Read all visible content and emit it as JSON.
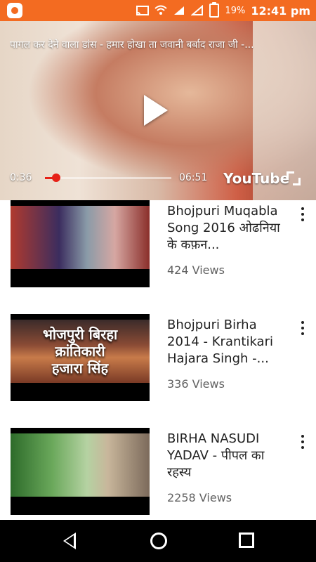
{
  "status": {
    "battery": "19%",
    "time": "12:41 pm",
    "accent": "#f36b21",
    "icons": [
      "app-icon",
      "cast-icon",
      "wifi-icon",
      "signal-icon",
      "signal-empty-icon",
      "battery-icon"
    ]
  },
  "player": {
    "title": "पागल कर देने वाला डांस - हमार होखा ता जवानी बर्बाद राजा जी -...",
    "current_time": "0:36",
    "duration": "06:51",
    "progress_fraction": 0.088,
    "logo": "YouTube",
    "accent": "#e62117"
  },
  "videos": [
    {
      "title": "Bhojpuri Muqabla Song 2016 ओढनिया के कफ़न...",
      "views": "424 Views"
    },
    {
      "title": "Bhojpuri Birha 2014 - Krantikari Hajara Singh -...",
      "views": "336 Views",
      "thumb_text": [
        "भोजपुरी बिरहा",
        "क्रांतिकारी",
        "हजारा सिंह"
      ]
    },
    {
      "title": "BIRHA NASUDI YADAV - पीपल का रहस्य",
      "views": "2258 Views"
    }
  ],
  "navbar": {
    "buttons": [
      "back",
      "home",
      "recents"
    ]
  }
}
